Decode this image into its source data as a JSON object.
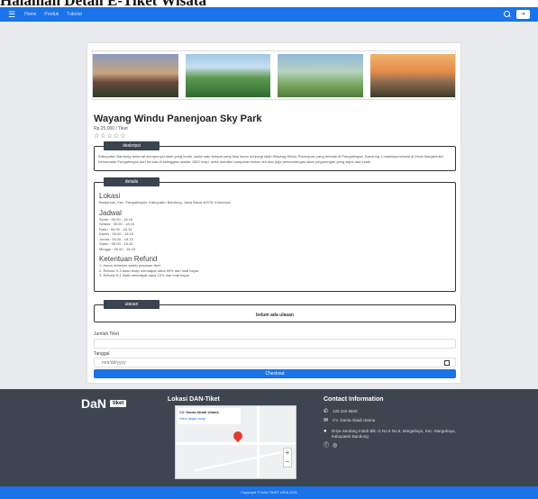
{
  "caption": "Halaman Detail E-Tiket Wisata",
  "nav": {
    "menu_icon": "menu-icon",
    "links": [
      "Home",
      "Produk",
      "Tutorial"
    ],
    "search_icon": "search-icon",
    "login_icon": "login-icon"
  },
  "product": {
    "title": "Wayang Windu Panenjoan Sky Park",
    "price": "Rp.25.000 / Tiket",
    "stars": "☆☆☆☆☆"
  },
  "deskripsi": {
    "tag": "deskripsi",
    "text": "Kabupaten Bandung terkenal mempunyai alam yang indah, salah satu tempat yang bisa kamu kunjungi ialah Wayang Windu Panenjoan yang terletak di Pangalengan, Bandung. Lokasinya berada di Desa Margamukti, Kecamatan Pangalengan dan berada di ketinggian sekitar 1800 mdpl, serta memiliki hamparan kebun teh dan juga pemandangan alam pegunungan yang sejuk dan indah."
  },
  "details": {
    "tag": "details",
    "lokasi_h": "Lokasi",
    "lokasi": "Banjarsari, Kec. Pangalengan, Kabupaten Bandung, Jawa Barat 40378, Indonesia",
    "jadwal_h": "Jadwal",
    "jadwal": [
      "Senin : 05.00 - 18.15",
      "Selasa : 05.00 - 18.15",
      "Rabu : 05.00 - 18.15",
      "Kamis : 05.00 - 18.15",
      "Jumat : 05.00 - 18.15",
      "Sabtu : 05.00 - 18.15",
      "Minggu : 05.00 - 18.15"
    ],
    "refund_h": "Ketentuan Refund",
    "refund": [
      "1. Harus sebelum waktu pesanan tiket",
      "2. Refund H-3 akan tetap mendapat dana 50% dari total bayar",
      "3. Refund H-1 tidak mendapat dana 10% dari total bayar"
    ]
  },
  "ulasan": {
    "tag": "ulasan",
    "empty": "belum ada ulasan"
  },
  "form": {
    "jumlah_label": "Jumlah Tiket",
    "tanggal_label": "Tanggal",
    "tanggal_placeholder": "mm/dd/yyyy",
    "calendar_icon": "calendar-icon",
    "checkout": "Checkout"
  },
  "footer": {
    "logo_text": "DaN",
    "logo_badge": "tiket",
    "lokasi_h": "Lokasi DAN-Tiket",
    "map_title": "CV. Dania Abadi Utama",
    "map_link": "View larger map",
    "contact_h": "Contact Information",
    "phone": "120 240 9600",
    "email": "CV. Dania Abadi Utama",
    "address": "Griya Serdang Indah Blk. G No.5 No.6, Margahayu, Kec. Margahayu, Kabupaten Bandung",
    "social_icons": [
      "facebook-icon",
      "instagram-icon"
    ],
    "copyright": "Copyright © DAN TIKET  ARIA 2021"
  }
}
